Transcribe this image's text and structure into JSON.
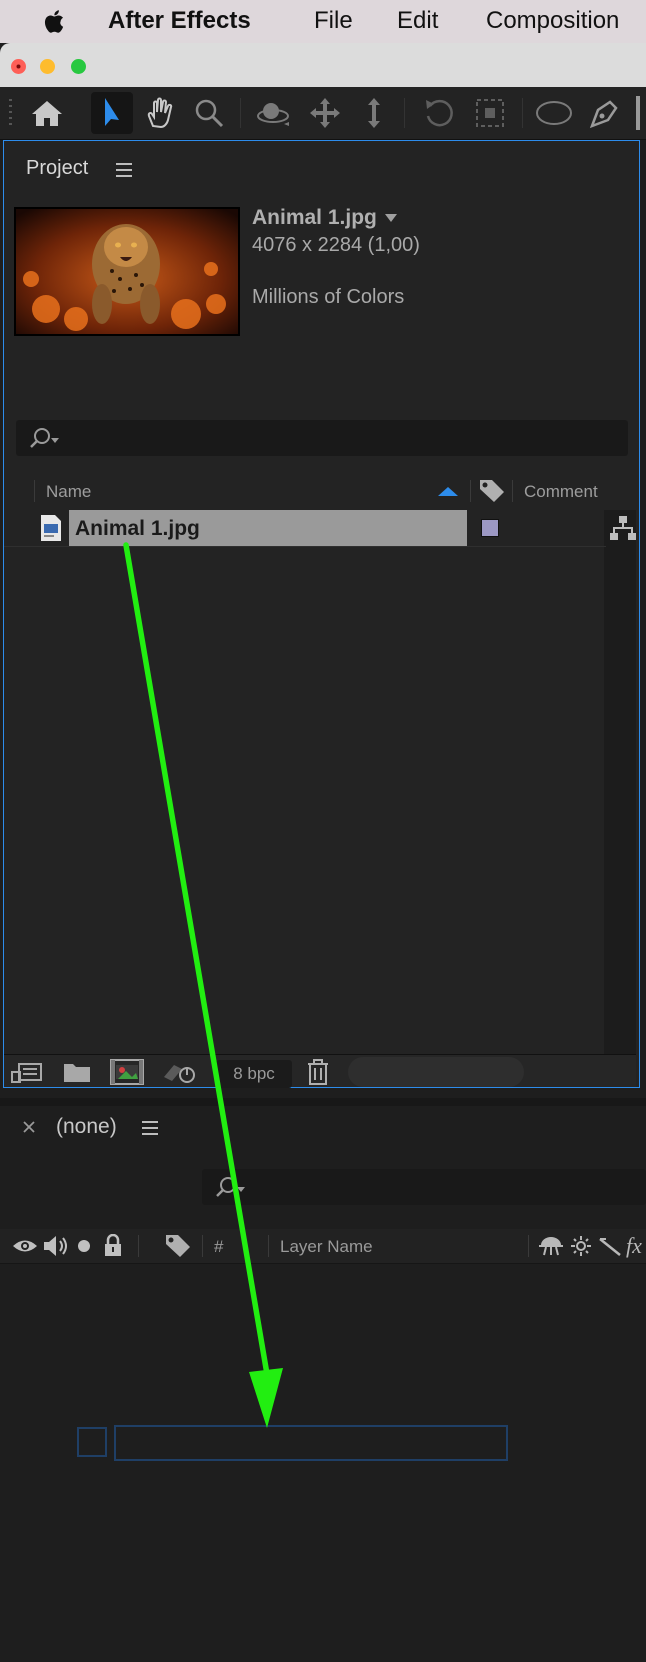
{
  "menubar": {
    "app_name": "After Effects",
    "items": [
      "File",
      "Edit",
      "Composition"
    ]
  },
  "window": {
    "traffic_lights": {
      "close": "#fe5f57",
      "minimize": "#febc2e",
      "zoom": "#28c840"
    }
  },
  "toolbar": {
    "tools": [
      "home-icon",
      "selection-tool-icon",
      "hand-tool-icon",
      "zoom-tool-icon",
      "orbit-camera-icon",
      "pan-camera-icon",
      "dolly-camera-icon",
      "rotation-tool-icon",
      "pan-behind-icon",
      "ellipse-tool-icon",
      "pen-tool-icon"
    ],
    "active_tool": "selection-tool-icon",
    "accent_color": "#2d8ceb"
  },
  "project_panel": {
    "title": "Project",
    "preview": {
      "file_name": "Animal 1.jpg",
      "dimensions": "4076 x 2284 (1,00)",
      "color_depth": "Millions of Colors"
    },
    "columns": {
      "name": "Name",
      "comment": "Comment"
    },
    "items": [
      {
        "name": "Animal 1.jpg",
        "type": "jpg",
        "label_color": "#9c98c4"
      }
    ],
    "footer": {
      "bpc": "8 bpc"
    }
  },
  "timeline_panel": {
    "title": "(none)",
    "columns": {
      "number": "#",
      "layer_name": "Layer Name"
    }
  },
  "annotation": {
    "arrow_color": "#22ee11"
  }
}
